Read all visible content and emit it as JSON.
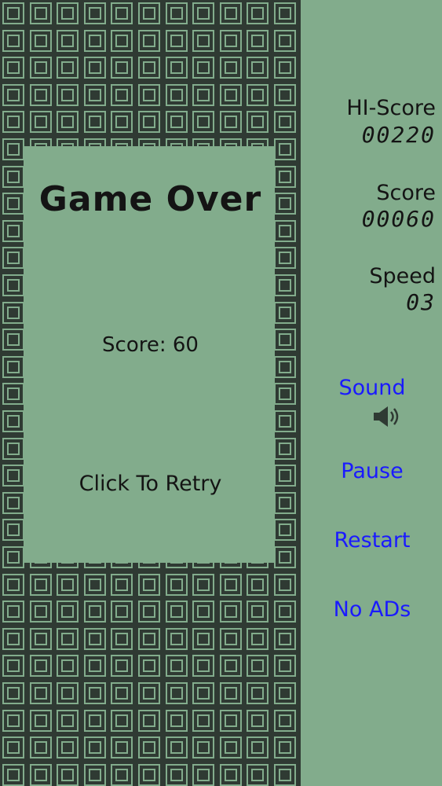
{
  "overlay": {
    "title": "Game Over",
    "score_text": "Score: 60",
    "retry_text": "Click To Retry"
  },
  "stats": {
    "hi_score_label": "HI-Score",
    "hi_score_value": "00220",
    "score_label": "Score",
    "score_value": "00060",
    "speed_label": "Speed",
    "speed_value": "03"
  },
  "menu": {
    "sound_label": "Sound",
    "sound_icon": "speaker-icon",
    "pause_label": "Pause",
    "restart_label": "Restart",
    "no_ads_label": "No ADs"
  },
  "colors": {
    "background": "#82ac8c",
    "block": "#2f3a33",
    "text": "#141414",
    "link": "#1a1aff"
  }
}
